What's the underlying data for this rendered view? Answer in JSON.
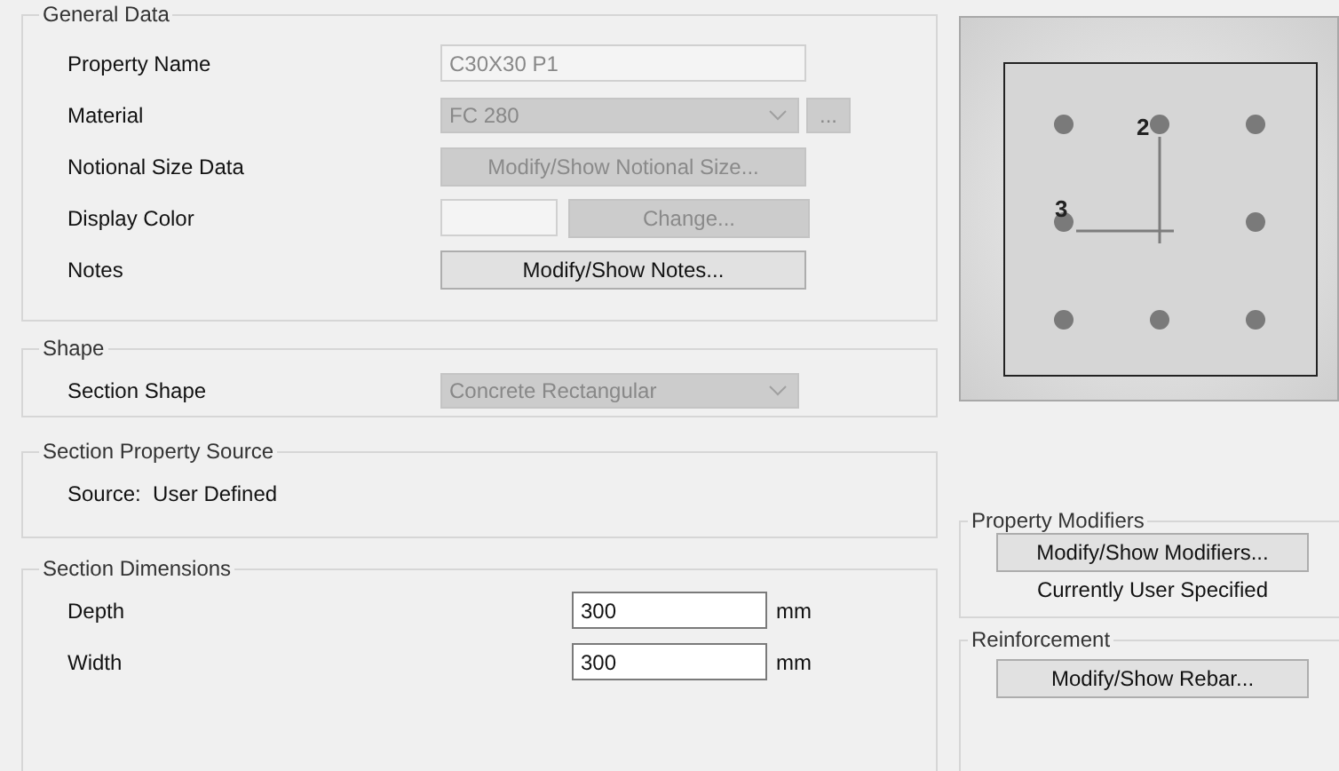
{
  "general_data": {
    "title": "General Data",
    "rows": [
      {
        "label": "Property Name",
        "kind": "text",
        "value": "C30X30 P1",
        "disabled": true
      },
      {
        "label": "Material",
        "kind": "combo",
        "value": "FC 280",
        "disabled": true,
        "extra_button": "..."
      },
      {
        "label": "Notional Size Data",
        "kind": "button",
        "button": "Modify/Show Notional Size...",
        "disabled": true
      },
      {
        "label": "Display Color",
        "kind": "color",
        "button": "Change...",
        "disabled": true
      },
      {
        "label": "Notes",
        "kind": "button",
        "button": "Modify/Show Notes...",
        "disabled": false
      }
    ]
  },
  "shape": {
    "title": "Shape",
    "label": "Section Shape",
    "value": "Concrete Rectangular",
    "disabled": true
  },
  "property_source": {
    "title": "Section Property Source",
    "text": "Source:  User Defined"
  },
  "dimensions": {
    "title": "Section Dimensions",
    "rows": [
      {
        "label": "Depth",
        "value": "300",
        "unit": "mm"
      },
      {
        "label": "Width",
        "value": "300",
        "unit": "mm"
      }
    ]
  },
  "preview": {
    "axis_2_label": "2",
    "axis_3_label": "3"
  },
  "property_modifiers": {
    "title": "Property Modifiers",
    "button": "Modify/Show Modifiers...",
    "status": "Currently User Specified"
  },
  "reinforcement": {
    "title": "Reinforcement",
    "button": "Modify/Show Rebar..."
  }
}
